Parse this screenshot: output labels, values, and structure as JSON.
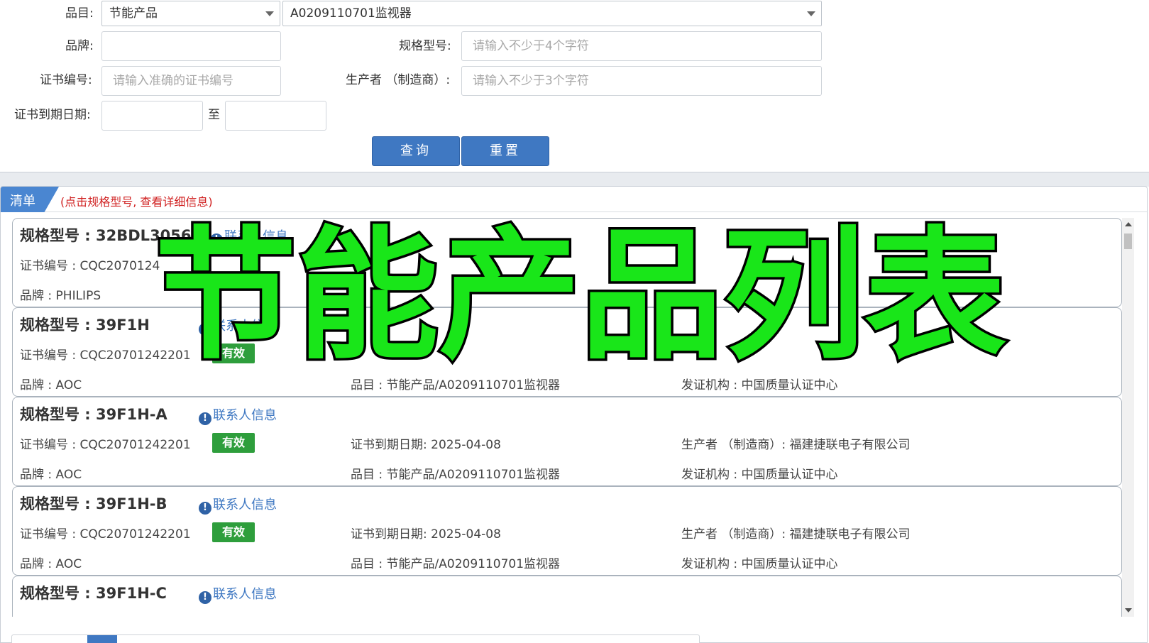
{
  "form": {
    "category_label": "品目:",
    "category_value": "节能产品",
    "subcategory_value": "A0209110701监视器",
    "brand_label": "品牌:",
    "model_label": "规格型号:",
    "model_placeholder": "请输入不少于4个字符",
    "cert_no_label": "证书编号:",
    "cert_no_placeholder": "请输入准确的证书编号",
    "producer_label": "生产者 （制造商）:",
    "producer_placeholder": "请输入不少于3个字符",
    "expiry_label": "证书到期日期:",
    "to_label": "至",
    "query_button": "查询",
    "reset_button": "重置"
  },
  "list": {
    "tab_label": "清单",
    "hint": "(点击规格型号, 查看详细信息)",
    "contact_label": "联系人信息",
    "items": [
      {
        "model": "规格型号 : 32BDL3056Q",
        "cert": "证书编号 : CQC2070124",
        "status": "",
        "expiry": "",
        "producer": "",
        "brand": "品牌 : PHILIPS",
        "category": "",
        "issuer": ""
      },
      {
        "model": "规格型号 : 39F1H",
        "cert": "证书编号 : CQC20701242201",
        "status": "有效",
        "expiry": "",
        "producer": "",
        "brand": "品牌 : AOC",
        "category": "品目 : 节能产品/A0209110701监视器",
        "issuer": "发证机构 : 中国质量认证中心"
      },
      {
        "model": "规格型号 : 39F1H-A",
        "cert": "证书编号 : CQC20701242201",
        "status": "有效",
        "expiry": "证书到期日期: 2025-04-08",
        "producer": "生产者 （制造商）: 福建捷联电子有限公司",
        "brand": "品牌 : AOC",
        "category": "品目 : 节能产品/A0209110701监视器",
        "issuer": "发证机构 : 中国质量认证中心"
      },
      {
        "model": "规格型号 : 39F1H-B",
        "cert": "证书编号 : CQC20701242201",
        "status": "有效",
        "expiry": "证书到期日期: 2025-04-08",
        "producer": "生产者 （制造商）: 福建捷联电子有限公司",
        "brand": "品牌 : AOC",
        "category": "品目 : 节能产品/A0209110701监视器",
        "issuer": "发证机构 : 中国质量认证中心"
      },
      {
        "model": "规格型号 : 39F1H-C",
        "cert": "",
        "status": "",
        "expiry": "",
        "producer": "",
        "brand": "",
        "category": "",
        "issuer": ""
      }
    ]
  },
  "overlay_title": "节能产品列表",
  "colors": {
    "primary": "#3f78c2",
    "valid_badge": "#2e9e3c",
    "hint_red": "#d02020",
    "overlay_green": "#19e619"
  }
}
